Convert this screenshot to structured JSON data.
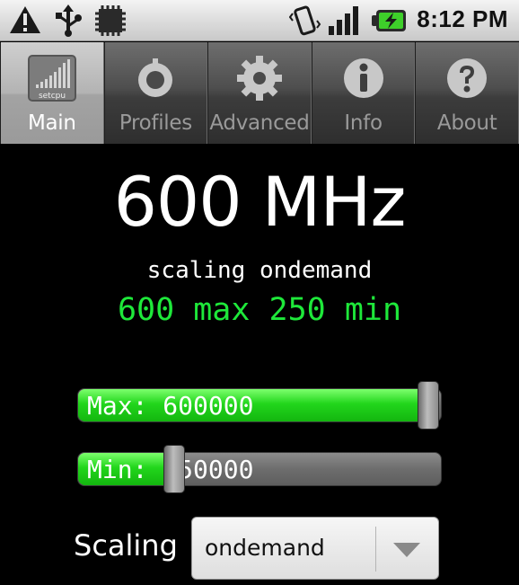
{
  "status_bar": {
    "time": "8:12 PM",
    "icons": [
      "warning-icon",
      "usb-icon",
      "chip-icon",
      "vibrate-icon",
      "signal-icon",
      "battery-charging-icon"
    ]
  },
  "tabs": [
    {
      "label": "Main",
      "icon": "setcpu-icon",
      "selected": true,
      "icon_text": "setcpu"
    },
    {
      "label": "Profiles",
      "icon": "profiles-icon",
      "selected": false
    },
    {
      "label": "Advanced",
      "icon": "gear-icon",
      "selected": false
    },
    {
      "label": "Info",
      "icon": "info-icon",
      "selected": false
    },
    {
      "label": "About",
      "icon": "help-icon",
      "selected": false
    }
  ],
  "main": {
    "frequency": "600 MHz",
    "governor_line": "scaling ondemand",
    "range_line": "600 max 250 min"
  },
  "sliders": {
    "max": {
      "text": "Max: 600000",
      "fraction": 0.965
    },
    "min": {
      "text": "Min: 250000",
      "fraction": 0.265
    }
  },
  "scaling": {
    "label": "Scaling",
    "selected": "ondemand"
  },
  "colors": {
    "accent_green": "#1ee83a",
    "slider_fill": "#22d61c"
  }
}
